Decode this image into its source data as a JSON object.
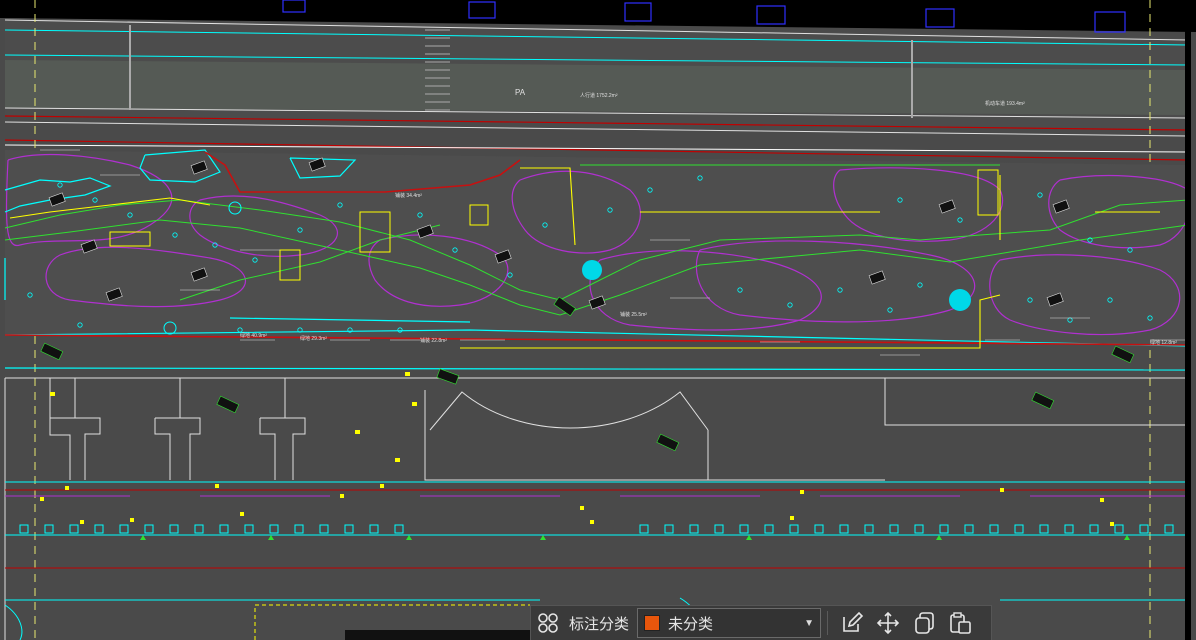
{
  "colors": {
    "background": "#4a4a4a",
    "paving": "#5a5a5a",
    "cyan": "#00ffff",
    "yellow": "#ffff00",
    "magenta": "#b030d0",
    "green": "#30e030",
    "red": "#c00000",
    "white": "#ffffff",
    "toolbar_bg": "#3a3a3a",
    "category_swatch": "#e8560c"
  },
  "drawing": {
    "pa_label": "PA",
    "pa_tag": "PA",
    "area_labels": [
      "人行道 1752.2m²",
      "机动车道 193.4m²",
      "绿地 40.9m²",
      "铺装 34.4m²",
      "绿地 12.8m²",
      "铺装 22.8m²",
      "绿地 29.3m²",
      "铺装 25.5m²"
    ]
  },
  "toolbar": {
    "category_label": "标注分类",
    "selected_category": "未分类",
    "layout_icon": "grid-icon",
    "edit_icon": "edit-icon",
    "move_icon": "move-icon",
    "copy_icon": "copy-icon",
    "paste_icon": "paste-icon"
  }
}
